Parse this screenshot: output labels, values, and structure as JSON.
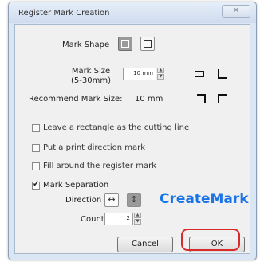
{
  "window": {
    "title": "Register Mark Creation",
    "close_glyph": "✕"
  },
  "mark_shape": {
    "label": "Mark Shape",
    "selected": "corner-marks"
  },
  "mark_size": {
    "label": "Mark Size",
    "range": "(5-30mm)",
    "value": "10 mm"
  },
  "recommend": {
    "label": "Recommend Mark Size:",
    "value": "10 mm"
  },
  "options": {
    "rect_cut": {
      "label": "Leave a rectangle as the cutting line",
      "checked": false
    },
    "print_dir": {
      "label": "Put a print direction mark",
      "checked": false
    },
    "fill_around": {
      "label": "Fill around the register mark",
      "checked": false
    },
    "separation": {
      "label": "Mark Separation",
      "checked": true
    }
  },
  "separation": {
    "direction_label": "Direction",
    "horizontal_glyph": "↔",
    "vertical_glyph": "↕",
    "selected": "vertical",
    "count_label": "Count",
    "count_value": "2"
  },
  "buttons": {
    "cancel": "Cancel",
    "ok": "OK"
  },
  "annotation": {
    "text": "CreateMark",
    "color": "#1a74e8",
    "highlight_color": "#d82c2c"
  },
  "icons": {
    "spin_up": "▲",
    "spin_down": "▼",
    "tick": "✔"
  }
}
